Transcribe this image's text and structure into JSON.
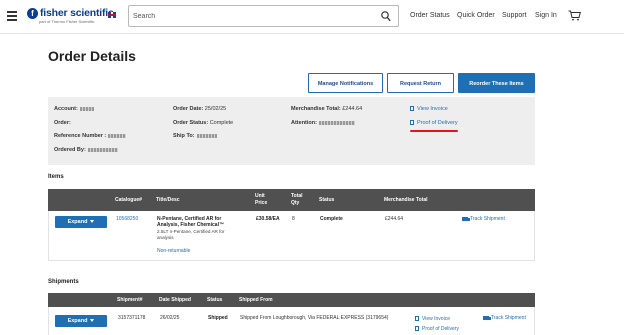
{
  "header": {
    "logo_text": "fisher scientific",
    "logo_tagline": "part of Thermo Fisher Scientific",
    "search_placeholder": "Search",
    "nav": [
      "Order Status",
      "Quick Order",
      "Support",
      "Sign In"
    ]
  },
  "page": {
    "title": "Order Details",
    "buttons": {
      "manage_notifications": "Manage Notifications",
      "request_return": "Request Return",
      "reorder": "Reorder These Items"
    }
  },
  "summary": {
    "account_label": "Account:",
    "order_label": "Order:",
    "reference_label": "Reference Number :",
    "ordered_by_label": "Ordered By:",
    "order_date_label": "Order Date:",
    "order_date": "25/02/25",
    "order_status_label": "Order Status:",
    "order_status": "Complete",
    "ship_to_label": "Ship To:",
    "merch_total_label": "Merchandise Total:",
    "merch_total": "£244.64",
    "attention_label": "Attention:",
    "view_invoice": "View Invoice",
    "proof_of_delivery": "Proof of Delivery"
  },
  "items": {
    "section_title": "Items",
    "headers": {
      "catalogue": "Catalogue#",
      "title": "Title/Desc",
      "unit_price_1": "Unit",
      "unit_price_2": "Price",
      "total_qty_1": "Total",
      "total_qty_2": "Qty",
      "status": "Status",
      "merch_total": "Merchandise Total"
    },
    "row": {
      "expand": "Expand",
      "catalogue": "10568250",
      "title_1": "N-Pentane, Certified AR for",
      "title_2": "Analysis, Fisher Chemical™",
      "desc_1": "2.5LT n-Pentane, Certified AR for",
      "desc_2": "analysis",
      "non_returnable": "Non-returnable",
      "unit_price": "£30.58/EA",
      "qty": "8",
      "status": "Complete",
      "merch_total": "£244.64",
      "track": "Track Shipment"
    }
  },
  "shipments": {
    "section_title": "Shipments",
    "headers": {
      "shipment": "Shipment#",
      "date_shipped": "Date Shipped",
      "status": "Status",
      "shipped_from": "Shipped From"
    },
    "row": {
      "expand": "Expand",
      "shipment": "3157371178",
      "date_shipped": "26/02/25",
      "status": "Shipped",
      "shipped_from": "Shipped From Loughborough, Via FEDERAL EXPRESS (3179654)",
      "view_invoice": "View Invoice",
      "proof_of_delivery": "Proof of Delivery",
      "track": "Track Shipment"
    }
  },
  "colors": {
    "brand": "#0b3e91",
    "accent": "#1f6fb4",
    "table_header": "#505050",
    "highlight": "#e0151e"
  }
}
